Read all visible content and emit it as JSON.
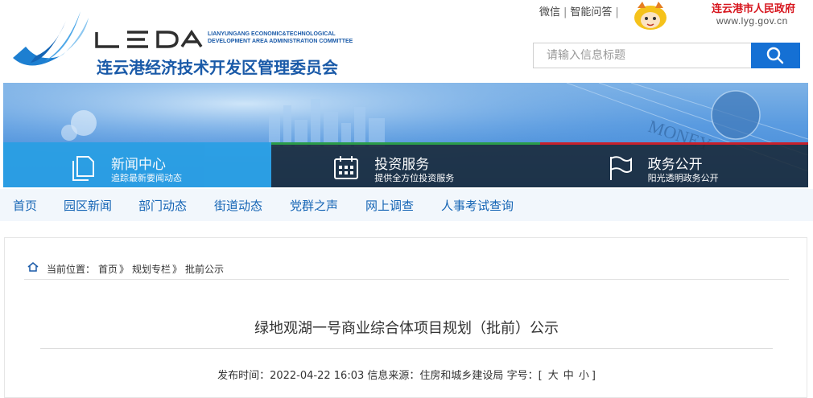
{
  "header": {
    "logo_letters": "LEDA",
    "logo_en_line1": "LIANYUNGANG ECONOMIC&TECHNOLOGICAL",
    "logo_en_line2": "DEVELOPMENT AREA ADMINISTRATION COMMITTEE",
    "logo_cn": "连云港经济技术开发区管理委员会",
    "links": [
      "微信",
      "智能问答"
    ],
    "separator": "|",
    "gov_name": "连云港市人民政府",
    "gov_url": "www.lyg.gov.cn",
    "search_placeholder": "请输入信息标题",
    "icons": {
      "search": "search-icon",
      "mascot": "mascot-icon"
    }
  },
  "banner": {
    "background_text": "MONEY",
    "tiles": [
      {
        "title": "新闻中心",
        "subtitle": "追踪最新要闻动态",
        "icon": "document-icon"
      },
      {
        "title": "投资服务",
        "subtitle": "提供全方位投资服务",
        "icon": "calendar-icon"
      },
      {
        "title": "政务公开",
        "subtitle": "阳光透明政务公开",
        "icon": "flag-icon"
      }
    ]
  },
  "nav": {
    "items": [
      "首页",
      "园区新闻",
      "部门动态",
      "街道动态",
      "党群之声",
      "网上调查",
      "人事考试查询"
    ]
  },
  "breadcrumb": {
    "prefix": "当前位置：",
    "items": [
      "首页",
      "规划专栏",
      "批前公示"
    ],
    "separator": "》"
  },
  "article": {
    "title": "绿地观湖一号商业综合体项目规划（批前）公示",
    "publish_label": "发布时间：",
    "publish_time": "2022-04-22 16:03",
    "source_label": "信息来源：",
    "source": "住房和城乡建设局",
    "font_label": "字号：[",
    "font_sizes": [
      "大",
      "中",
      "小"
    ],
    "font_close": "]"
  },
  "colors": {
    "brand_blue": "#1a5aa8",
    "nav_blue": "#1565b5",
    "search_blue": "#1570d4",
    "gov_red": "#d7161e",
    "tile_green": "#2b9c4a",
    "tile_red": "#c8202c"
  }
}
